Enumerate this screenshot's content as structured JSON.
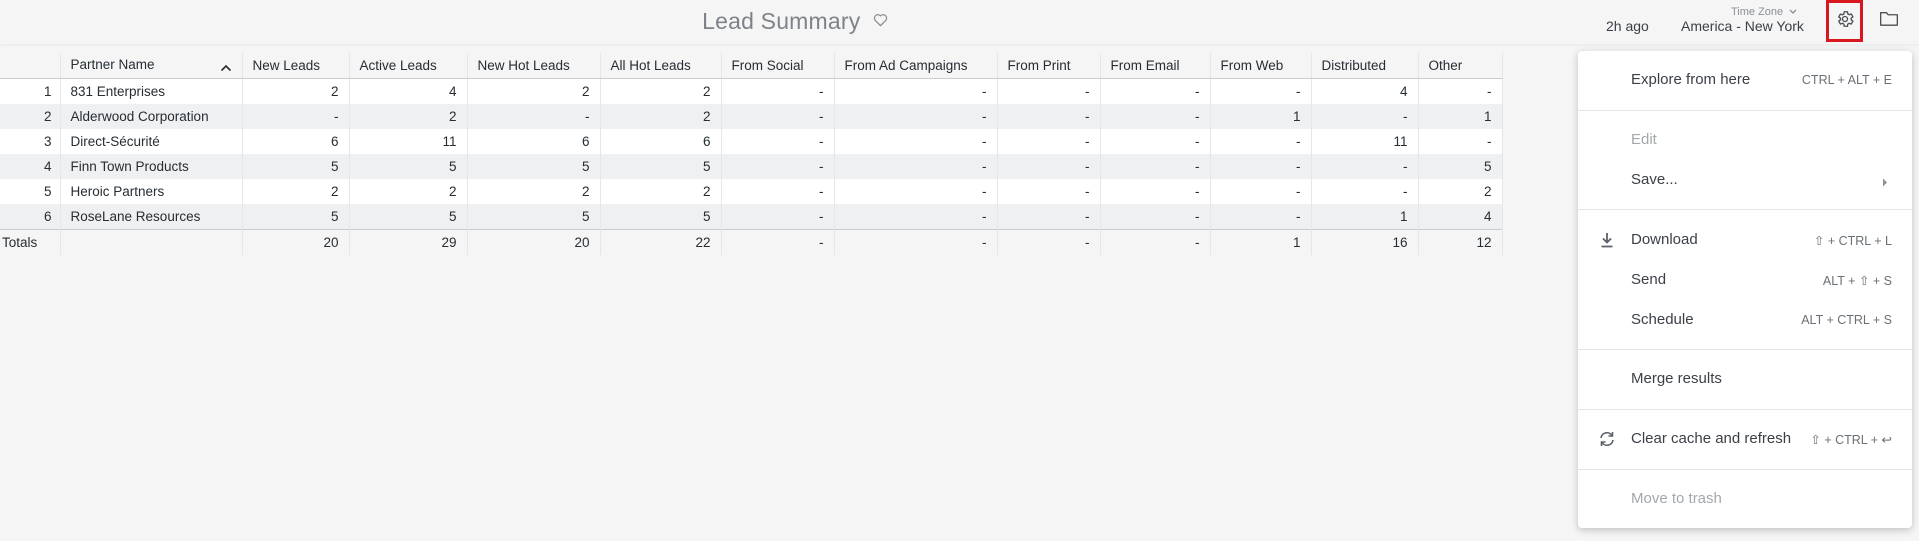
{
  "header": {
    "title": "Lead Summary",
    "last_run": "2h ago",
    "timezone_label": "Time Zone",
    "timezone_value": "America - New York"
  },
  "table": {
    "columns": [
      "Partner Name",
      "New Leads",
      "Active Leads",
      "New Hot Leads",
      "All Hot Leads",
      "From Social",
      "From Ad Campaigns",
      "From Print",
      "From Email",
      "From Web",
      "Distributed",
      "Other"
    ],
    "rows": [
      [
        "1",
        "831 Enterprises",
        "2",
        "4",
        "2",
        "2",
        "-",
        "-",
        "-",
        "-",
        "-",
        "4",
        "-"
      ],
      [
        "2",
        "Alderwood Corporation",
        "-",
        "2",
        "-",
        "2",
        "-",
        "-",
        "-",
        "-",
        "1",
        "-",
        "1"
      ],
      [
        "3",
        "Direct-Sécurité",
        "6",
        "11",
        "6",
        "6",
        "-",
        "-",
        "-",
        "-",
        "-",
        "11",
        "-"
      ],
      [
        "4",
        "Finn Town Products",
        "5",
        "5",
        "5",
        "5",
        "-",
        "-",
        "-",
        "-",
        "-",
        "-",
        "5"
      ],
      [
        "5",
        "Heroic Partners",
        "2",
        "2",
        "2",
        "2",
        "-",
        "-",
        "-",
        "-",
        "-",
        "-",
        "2"
      ],
      [
        "6",
        "RoseLane Resources",
        "5",
        "5",
        "5",
        "5",
        "-",
        "-",
        "-",
        "-",
        "-",
        "1",
        "4"
      ]
    ],
    "totals_label": "Totals",
    "totals": [
      "",
      "20",
      "29",
      "20",
      "22",
      "-",
      "-",
      "-",
      "-",
      "1",
      "16",
      "12"
    ]
  },
  "menu": {
    "explore": {
      "label": "Explore from here",
      "shortcut": "CTRL + ALT + E"
    },
    "edit": {
      "label": "Edit"
    },
    "save": {
      "label": "Save..."
    },
    "download": {
      "label": "Download",
      "shortcut": "⇧ + CTRL + L"
    },
    "send": {
      "label": "Send",
      "shortcut": "ALT + ⇧ + S"
    },
    "schedule": {
      "label": "Schedule",
      "shortcut": "ALT + CTRL + S"
    },
    "merge": {
      "label": "Merge results"
    },
    "clear_cache": {
      "label": "Clear cache and refresh",
      "shortcut": "⇧ + CTRL + ↩"
    },
    "trash": {
      "label": "Move to trash"
    }
  },
  "colors": {
    "highlight_border": "#d9171f",
    "stripe": "#eff0f1",
    "disabled_text": "#a3a8ad"
  },
  "icons": [
    "heart-icon",
    "chevron-down-icon",
    "gear-icon",
    "folder-icon",
    "sort-asc-icon",
    "download-icon",
    "refresh-icon",
    "chevron-right-icon"
  ]
}
